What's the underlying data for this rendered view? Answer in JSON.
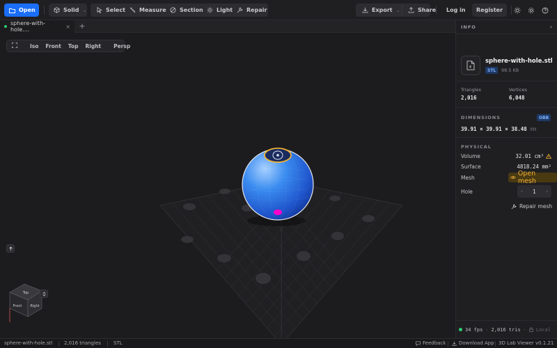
{
  "toolbar": {
    "open_label": "Open",
    "mode_label": "Solid",
    "tools": [
      {
        "label": "Select",
        "icon": "cursor-icon"
      },
      {
        "label": "Measure",
        "icon": "ruler-icon"
      },
      {
        "label": "Section",
        "icon": "section-icon"
      },
      {
        "label": "Light",
        "icon": "sun-icon"
      },
      {
        "label": "Repair",
        "icon": "wrench-icon"
      }
    ],
    "export_label": "Export",
    "share_label": "Share",
    "login_label": "Log in",
    "register_label": "Register"
  },
  "tabs": {
    "active_tab": "sphere-with-hole....",
    "add_label": "+",
    "close_label": "×"
  },
  "viewbar": {
    "views": [
      "Iso",
      "Front",
      "Top",
      "Right",
      "Persp"
    ]
  },
  "navcube": {
    "top_face": "Top",
    "front_face": "Front",
    "right_face": "Right"
  },
  "panel": {
    "title": "INFO",
    "file_name": "sphere-with-hole.stl",
    "format": "STL",
    "file_size": "98.5 KB",
    "triangles_label": "Triangles",
    "triangles_value": "2,016",
    "vertices_label": "Vertices",
    "vertices_value": "6,048",
    "dimensions_title": "DIMENSIONS",
    "dimensions_badge": "OBB",
    "dimensions_value": "39.91 × 39.91 × 38.48",
    "dimensions_unit": "mm",
    "physical_title": "PHYSICAL",
    "volume_label": "Volume",
    "volume_value": "32.01 cm³",
    "surface_label": "Surface",
    "surface_value": "4818.24 mm²",
    "mesh_label": "Mesh",
    "mesh_value": "Open mesh",
    "hole_label": "Hole",
    "hole_value": "1",
    "repair_label": "Repair mesh",
    "fps": "34 fps",
    "tris": "2,016 tris",
    "mode": "Local"
  },
  "status": {
    "file": "sphere-with-hole.stl",
    "triangles": "2,016 triangles",
    "format": "STL",
    "feedback": "Feedback",
    "download": "Download App",
    "version": "3D Lab Viewer v0.1.21"
  },
  "colors": {
    "accent": "#1a6ef7",
    "warning": "#f2b233",
    "ok": "#2ecc71",
    "hole_marker": "#ff00cc"
  }
}
